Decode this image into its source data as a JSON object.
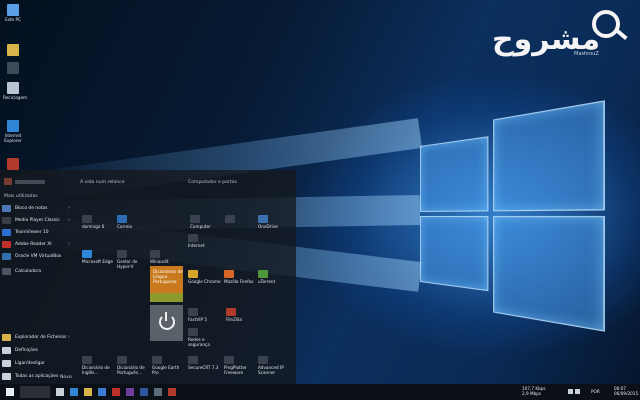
{
  "desktop": {
    "icons": [
      {
        "label": "Este PC",
        "icon": "computer-icon",
        "color": "#5aa0e6"
      },
      {
        "label": "",
        "icon": "user-folder-icon",
        "color": "#d8b24a"
      },
      {
        "label": "",
        "icon": "blurred-icon",
        "color": "#3d4a58"
      },
      {
        "label": "Reciclagem",
        "icon": "recycle-bin-icon",
        "color": "#b8c4d0"
      },
      {
        "label": "Internet Explorer",
        "icon": "internet-explorer-icon",
        "color": "#2f86d6"
      },
      {
        "label": "",
        "icon": "app-icon",
        "color": "#b23a2a"
      }
    ]
  },
  "logo": {
    "word": "مشروح",
    "sub": "MashrouZ"
  },
  "start_menu": {
    "section_recent": "Mais utilizadas",
    "groups": [
      "A vida num relance",
      "Computador e portas"
    ],
    "apps": [
      {
        "label": "Bloco de notas",
        "color": "#4f78b8",
        "arrow": "›"
      },
      {
        "label": "Media Player Classic",
        "color": "#3a3f46",
        "arrow": "›"
      },
      {
        "label": "TeamViewer 10",
        "color": "#2d6fd0",
        "arrow": ""
      },
      {
        "label": "Adobe Reader XI",
        "color": "#c0302a",
        "arrow": "›"
      },
      {
        "label": "Oracle VM VirtualBox",
        "color": "#3470b0",
        "arrow": ""
      },
      {
        "label": "Calculadora",
        "color": "#4b5563",
        "arrow": ""
      }
    ],
    "bottom": [
      {
        "label": "Explorador de Ficheiros",
        "icon": "folder-icon",
        "color": "#d8b24a",
        "arrow": "›"
      },
      {
        "label": "Definições",
        "icon": "gear-icon",
        "color": "#c9d1da",
        "arrow": ""
      },
      {
        "label": "Ligar/desligar",
        "icon": "power-icon",
        "color": "#c9d1da",
        "arrow": ""
      },
      {
        "label": "Todas as aplicações",
        "icon": "list-icon",
        "color": "#c9d1da",
        "arrow": ""
      }
    ],
    "new_label": "Novo",
    "tiles": [
      {
        "label": "domingo 6",
        "color": "#3a4250"
      },
      {
        "label": "Correio",
        "color": "#2f6bb0"
      },
      {
        "label": "Computer",
        "color": "#3a4250"
      },
      {
        "label": "",
        "color": "#3a4250"
      },
      {
        "label": "OneDrive",
        "color": "#3a6fb0"
      },
      {
        "label": "Internet",
        "color": "#3a4250"
      },
      {
        "label": "Microsoft Edge",
        "color": "#2f86d6"
      },
      {
        "label": "Gestor de Hyper-V",
        "color": "#3a4250"
      },
      {
        "label": "Winaudit",
        "color": "#3a4250"
      },
      {
        "label": "Google Chrome",
        "color": "#d7a52a"
      },
      {
        "label": "Mozilla Firefox",
        "color": "#d8652a"
      },
      {
        "label": "uTorrent",
        "color": "#4e9a3a"
      },
      {
        "label": "FastVIP 5",
        "color": "#3a4250"
      },
      {
        "label": "FileZilla",
        "color": "#b23a2a"
      },
      {
        "label": "Redes e segurança",
        "color": "#3a4250"
      },
      {
        "label": "Dicionário de Inglês...",
        "color": "#3a4250"
      },
      {
        "label": "Dicionário de Português...",
        "color": "#3a4250"
      },
      {
        "label": "Google Earth Pro",
        "color": "#3a4250"
      },
      {
        "label": "SecureCRT 7.3",
        "color": "#3a4250"
      },
      {
        "label": "PingPlotter Freeware",
        "color": "#3a4250"
      },
      {
        "label": "Advanced IP Scanner",
        "color": "#3a4250"
      }
    ],
    "orange_tile": {
      "label": "Dicionários de Língua Portuguesa",
      "color": "#c97a1f"
    },
    "power_tile": {
      "color": "#5a6168"
    }
  },
  "taskbar": {
    "buttons": [
      {
        "icon": "windows-icon",
        "color": "#e8eef5"
      },
      {
        "icon": "task-view-icon",
        "color": "#c9d1da"
      },
      {
        "icon": "edge-icon",
        "color": "#2f86d6"
      },
      {
        "icon": "explorer-icon",
        "color": "#d8b24a"
      },
      {
        "icon": "store-icon",
        "color": "#3a7bd5"
      },
      {
        "icon": "pdf-icon",
        "color": "#c0302a"
      },
      {
        "icon": "app-icon",
        "color": "#6b3ea0"
      },
      {
        "icon": "word-icon",
        "color": "#2b579a"
      },
      {
        "icon": "app-icon",
        "color": "#5a6b7a"
      },
      {
        "icon": "app-icon",
        "color": "#b23a2a"
      }
    ],
    "tray": {
      "net_up": "107,7 Kbps",
      "net_down": "2,9 Mbps",
      "language": "POR",
      "time": "08:07",
      "date": "06/09/2015"
    }
  }
}
